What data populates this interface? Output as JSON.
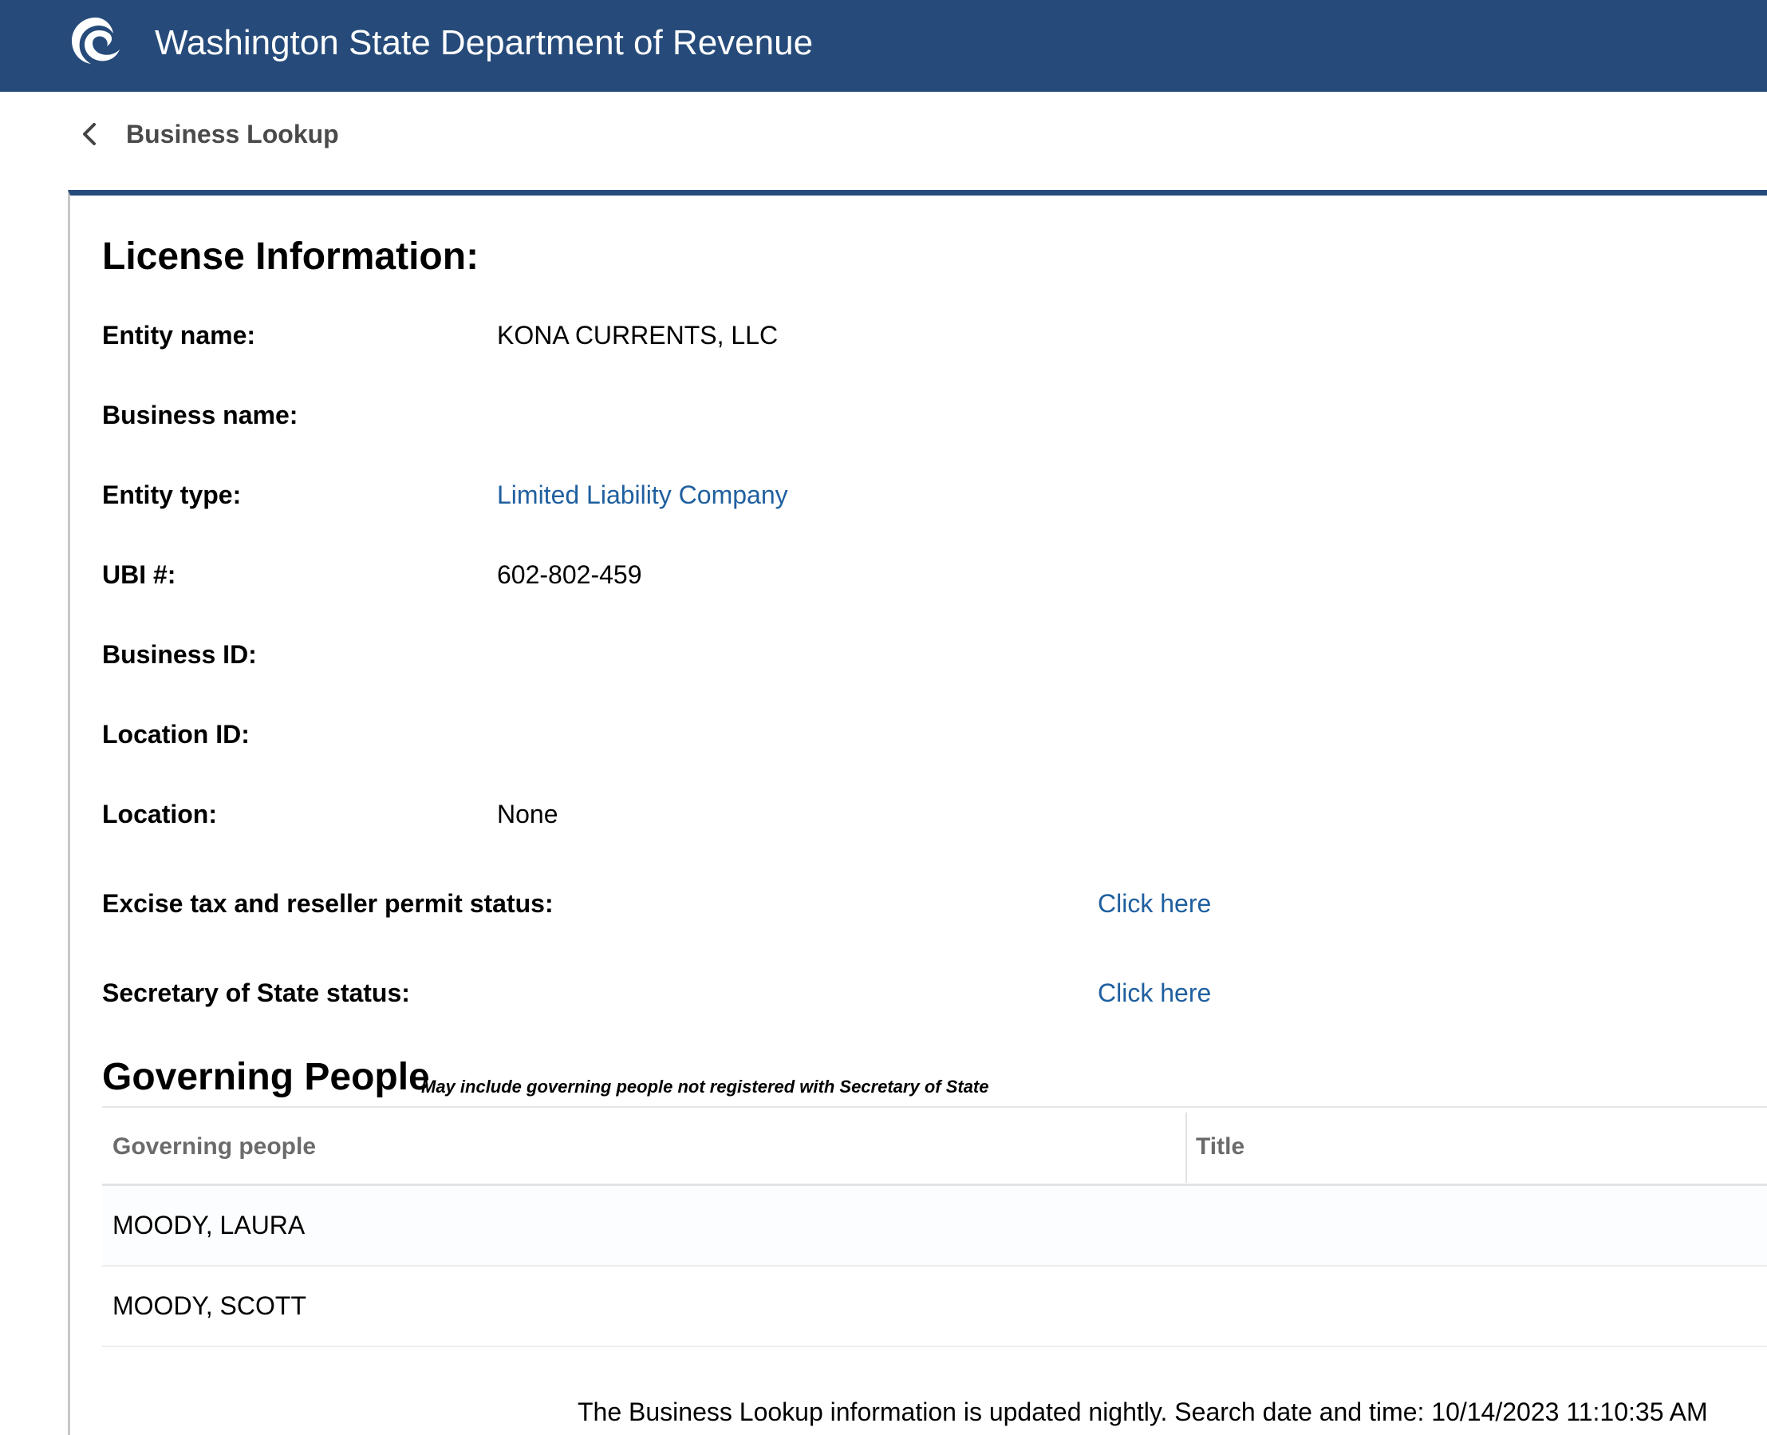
{
  "header": {
    "title": "Washington State Department of Revenue",
    "logo_icon": "dor-logo-icon",
    "background": "#264b7a"
  },
  "breadcrumb": {
    "back_icon": "chevron-left-icon",
    "label": "Business Lookup"
  },
  "license": {
    "heading": "License Information:",
    "fields": [
      {
        "label": "Entity name:",
        "value": "KONA CURRENTS, LLC"
      },
      {
        "label": "Business name:",
        "value": ""
      },
      {
        "label": "Entity type:",
        "value": "Limited Liability Company"
      },
      {
        "label": "UBI #:",
        "value": "602-802-459"
      },
      {
        "label": "Business ID:",
        "value": ""
      },
      {
        "label": "Location ID:",
        "value": ""
      },
      {
        "label": "Location:",
        "value": "None"
      }
    ],
    "status_links": [
      {
        "label": "Excise tax and reseller permit status:",
        "link": "Click here"
      },
      {
        "label": "Secretary of State status:",
        "link": "Click here"
      }
    ],
    "link_color": "#1f5f9f"
  },
  "governing": {
    "heading": "Governing People",
    "note": "May include governing people not registered with Secretary of State",
    "columns": [
      "Governing people",
      "Title"
    ],
    "rows": [
      {
        "name": "MOODY, LAURA",
        "title": ""
      },
      {
        "name": "MOODY, SCOTT",
        "title": ""
      }
    ]
  },
  "footer": {
    "note": "The Business Lookup information is updated nightly. Search date and time: 10/14/2023 11:10:35 AM"
  }
}
